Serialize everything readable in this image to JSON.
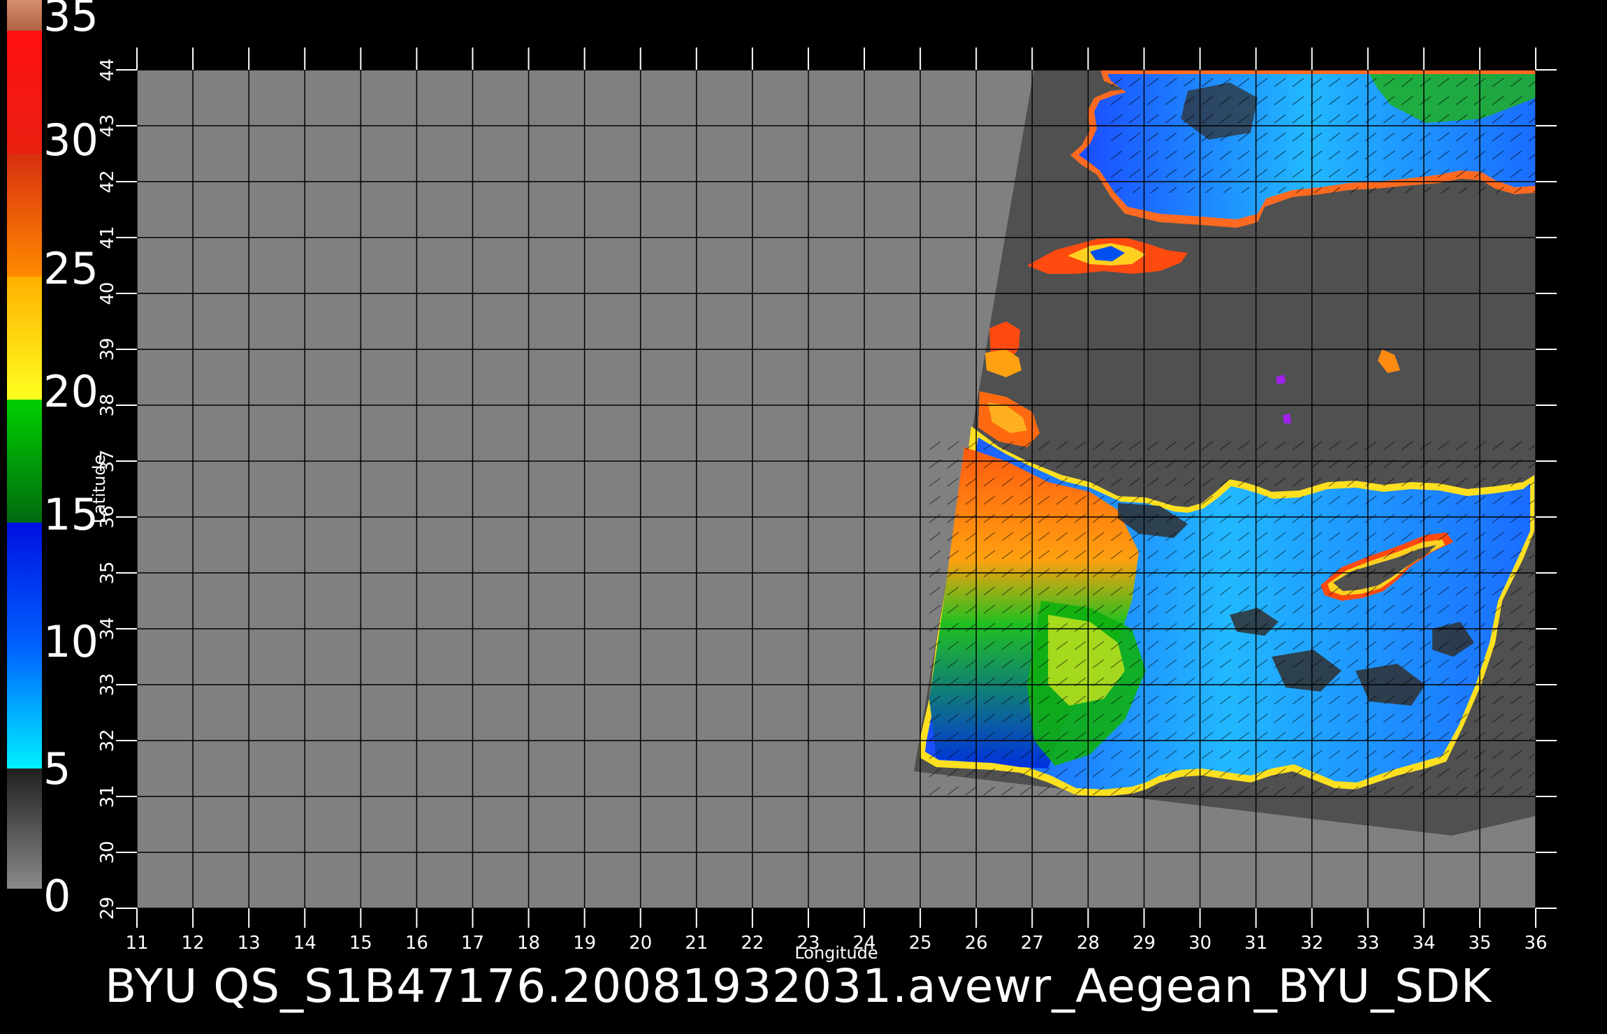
{
  "colorbar": {
    "labels": [
      "35",
      "30",
      "25",
      "20",
      "15",
      "10",
      "5",
      "0"
    ],
    "colors": {
      "top_cap": "#c97e5a",
      "red": "#ff1a0a",
      "orange": "#ff6a00",
      "yellow": "#ffe000",
      "green": "#00b400",
      "blue": "#0040ff",
      "cyan": "#00e8ff",
      "gray": "#3a3a3a"
    }
  },
  "map": {
    "background_color": "#808080",
    "swath_color": "#505050",
    "x_axis_label": "Longitude",
    "y_axis_label": "Latitude",
    "x_ticks": [
      "11",
      "12",
      "13",
      "14",
      "15",
      "16",
      "17",
      "18",
      "19",
      "20",
      "21",
      "22",
      "23",
      "24",
      "25",
      "26",
      "27",
      "28",
      "29",
      "30",
      "31",
      "32",
      "33",
      "34",
      "35",
      "36"
    ],
    "y_ticks": [
      "44",
      "43",
      "42",
      "41",
      "40",
      "39",
      "38",
      "37",
      "36",
      "35",
      "34",
      "33",
      "32",
      "31",
      "30",
      "29"
    ]
  },
  "footer": {
    "title": "BYU  QS_S1B47176.20081932031.avewr_Aegean_BYU_SDK"
  }
}
